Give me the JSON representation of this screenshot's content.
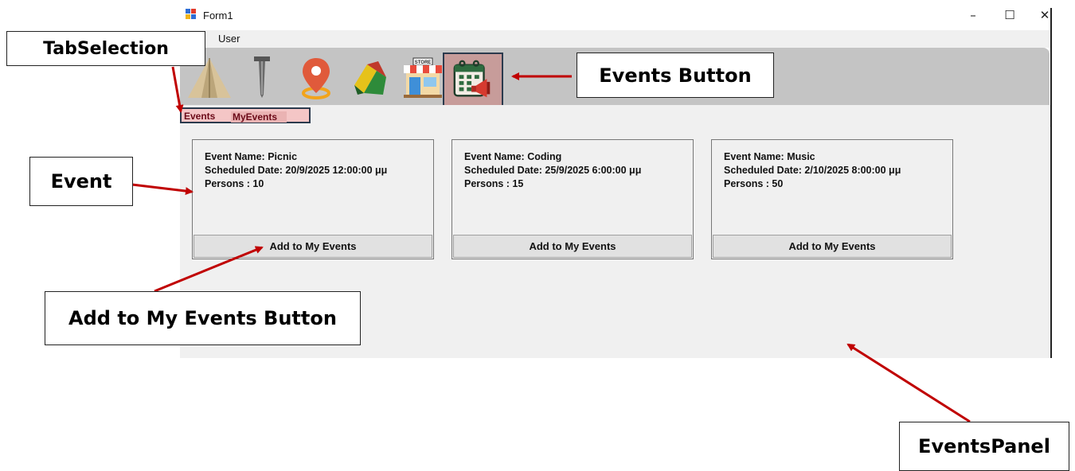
{
  "window": {
    "title": "Form1",
    "controls": {
      "minimize": "–",
      "maximize": "☐",
      "close": "✕"
    }
  },
  "menu": {
    "items": [
      {
        "label": "User"
      }
    ]
  },
  "toolbar": {
    "buttons": [
      {
        "icon": "tent-icon"
      },
      {
        "icon": "tent-stake-icon"
      },
      {
        "icon": "location-pin-icon"
      },
      {
        "icon": "sleeping-bag-icon"
      },
      {
        "icon": "store-icon",
        "text": "STORE"
      },
      {
        "icon": "events-calendar-icon",
        "active": true
      }
    ]
  },
  "tabs": [
    {
      "label": "Events"
    },
    {
      "label": "MyEvents"
    }
  ],
  "events": [
    {
      "name_line": "Event Name: Picnic",
      "date_line": "Scheduled Date: 20/9/2025 12:00:00 μμ",
      "persons_line": "Persons : 10",
      "button": "Add to My Events"
    },
    {
      "name_line": "Event Name: Coding",
      "date_line": "Scheduled Date: 25/9/2025 6:00:00 μμ",
      "persons_line": "Persons : 15",
      "button": "Add to My Events"
    },
    {
      "name_line": "Event Name: Music",
      "date_line": "Scheduled Date: 2/10/2025 8:00:00 μμ",
      "persons_line": "Persons : 50",
      "button": "Add to My Events"
    }
  ],
  "annotations": {
    "tab_selection": "TabSelection",
    "events_button": "Events Button",
    "event": "Event",
    "add_button": "Add to My Events Button",
    "events_panel": "EventsPanel"
  },
  "colors": {
    "toolbar_bg": "#c4c4c4",
    "active_button_bg": "#c79c9a",
    "tab_highlight": "#f4c6c6",
    "arrow": "#c00000",
    "panel_bg": "#f0f0f0"
  }
}
